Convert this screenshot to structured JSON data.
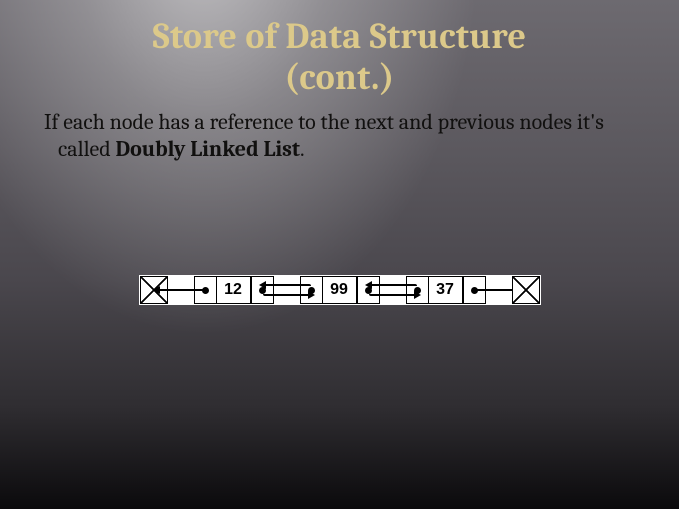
{
  "title": {
    "line1": "Store of Data Structure",
    "line2": "(cont.)"
  },
  "body": {
    "prefix": "If each node has a reference to the next and previous nodes it's called ",
    "bold": "Doubly Linked List",
    "suffix": "."
  },
  "diagram": {
    "type": "doubly-linked-list",
    "nodes": [
      {
        "value": "12"
      },
      {
        "value": "99"
      },
      {
        "value": "37"
      }
    ],
    "head_points_to_null": true,
    "tail_points_to_null": true
  }
}
